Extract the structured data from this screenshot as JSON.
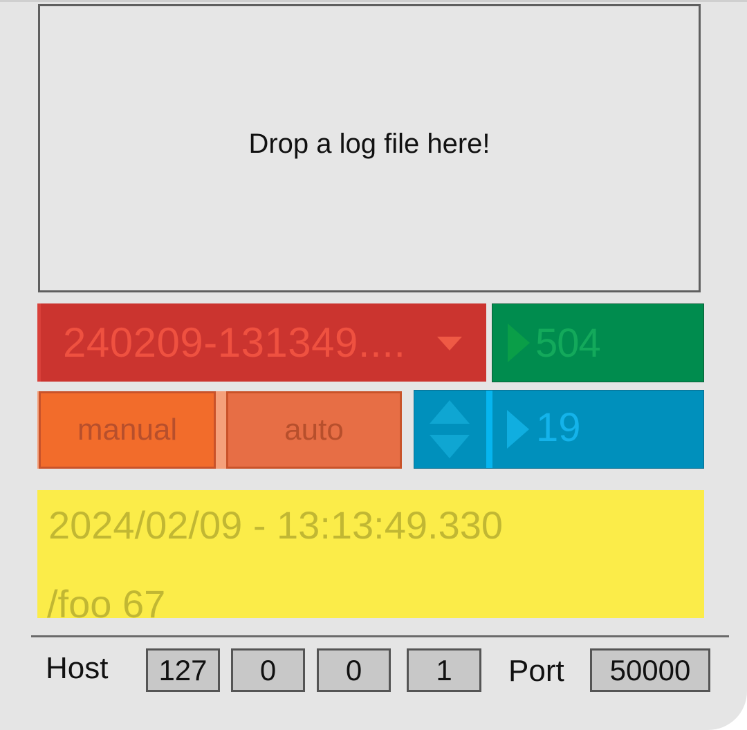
{
  "dropzone": {
    "text": "Drop a log file here!"
  },
  "file_menu": {
    "value": "240209-131349...."
  },
  "green_number": {
    "value": "504"
  },
  "mode_buttons": {
    "manual_label": "manual",
    "auto_label": "auto"
  },
  "blue_number": {
    "value": "19"
  },
  "message": {
    "timestamp": "2024/02/09 - 13:13:49.330",
    "content": "/foo 67"
  },
  "network": {
    "host_label": "Host",
    "host_octets": [
      "127",
      "0",
      "0",
      "1"
    ],
    "port_label": "Port",
    "port": "50000"
  },
  "colors": {
    "panel_bg": "#e5e5e5",
    "menu_red": "#cb342f",
    "number_green": "#008c4e",
    "button_orange": "#f26c2b",
    "number_blue": "#0090bc",
    "message_yellow": "#fbec49"
  },
  "icons": {
    "menu_caret": "chevron-down-icon",
    "number_arrow": "play-triangle-icon",
    "stepper": "up-down-arrows-icon"
  }
}
